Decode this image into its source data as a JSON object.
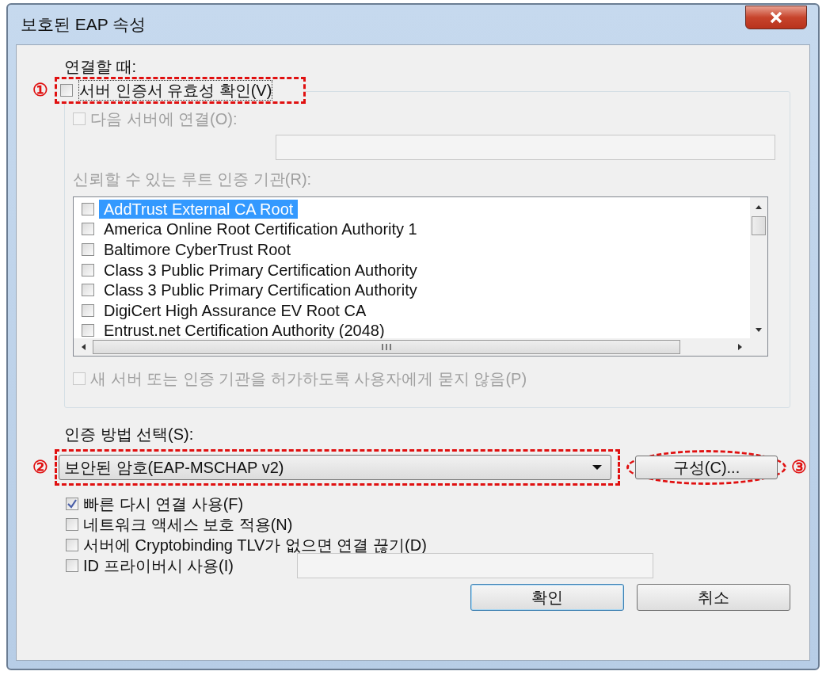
{
  "window": {
    "title": "보호된 EAP 속성"
  },
  "connect_heading": "연결할 때:",
  "validate_cert": {
    "label": "서버 인증서 유효성 확인(V)",
    "checked": false,
    "annotation": "①"
  },
  "connect_to_servers": {
    "label": "다음 서버에 연결(O):",
    "checked": false,
    "disabled": true
  },
  "trusted_roots_label": "신뢰할 수 있는 루트 인증 기관(R):",
  "root_cas": [
    {
      "name": "AddTrust External CA Root",
      "checked": false,
      "selected": true
    },
    {
      "name": "America Online Root Certification Authority 1",
      "checked": false,
      "selected": false
    },
    {
      "name": "Baltimore CyberTrust Root",
      "checked": false,
      "selected": false
    },
    {
      "name": "Class 3 Public Primary Certification Authority",
      "checked": false,
      "selected": false
    },
    {
      "name": "Class 3 Public Primary Certification Authority",
      "checked": false,
      "selected": false
    },
    {
      "name": "DigiCert High Assurance EV Root CA",
      "checked": false,
      "selected": false
    },
    {
      "name": "Entrust.net Certification Authority (2048)",
      "checked": false,
      "selected": false
    }
  ],
  "no_prompt": {
    "label": "새 서버 또는 인증 기관을 허가하도록 사용자에게 묻지 않음(P)",
    "checked": false,
    "disabled": true
  },
  "auth_method_label": "인증 방법 선택(S):",
  "auth_method": {
    "value": "보안된 암호(EAP-MSCHAP v2)",
    "annotation": "②"
  },
  "configure_button": {
    "label": "구성(C)...",
    "annotation": "③"
  },
  "options": [
    {
      "label": "빠른 다시 연결 사용(F)",
      "checked": true
    },
    {
      "label": "네트워크 액세스 보호 적용(N)",
      "checked": false
    },
    {
      "label": "서버에 Cryptobinding TLV가 없으면 연결 끊기(D)",
      "checked": false
    },
    {
      "label": "ID 프라이버시 사용(I)",
      "checked": false
    }
  ],
  "buttons": [
    {
      "label": "확인",
      "default": true
    },
    {
      "label": "취소",
      "default": false
    }
  ]
}
